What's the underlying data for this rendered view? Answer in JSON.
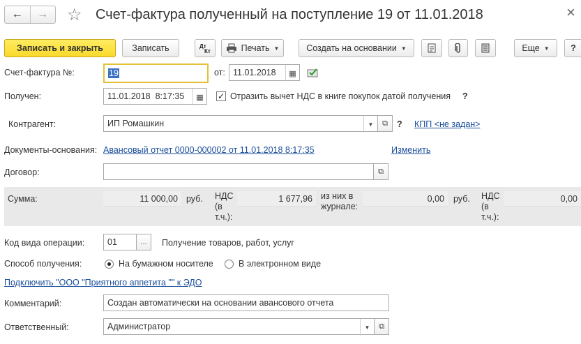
{
  "window": {
    "title": "Счет-фактура полученный на поступление 19 от 11.01.2018",
    "close_glyph": "×",
    "back_glyph": "←",
    "forward_glyph": "→",
    "star_glyph": "☆"
  },
  "toolbar": {
    "save_close_label": "Записать и закрыть",
    "save_label": "Записать",
    "print_label": "Печать",
    "create_based_label": "Создать на основании",
    "more_label": "Еще",
    "help_label": "?"
  },
  "form": {
    "invoice_label": "Счет-фактура №:",
    "invoice_number": "19",
    "from_label": "от:",
    "from_date": "11.01.2018",
    "received_label": "Получен:",
    "received_datetime": "11.01.2018  8:17:35",
    "vat_checkbox_label": "Отразить вычет НДС в книге покупок датой получения",
    "vat_checkbox_checked": true,
    "question_mark": "?",
    "counterparty_label": "Контрагент:",
    "counterparty_value": "ИП Ромашкин",
    "kpp_link": "КПП <не задан>",
    "basis_docs_label": "Документы-основания:",
    "basis_docs_link": "Авансовый отчет 0000-000002 от 11.01.2018 8:17:35",
    "change_link": "Изменить",
    "contract_label": "Договор:",
    "contract_value": ""
  },
  "sums": {
    "sum_label": "Сумма:",
    "sum_value": "11 000,00",
    "currency1": "руб.",
    "vat_label_1": "НДС",
    "vat_label_2": "(в",
    "vat_label_3": "т.ч.):",
    "vat_value": "1 677,96",
    "journal_label_1": "из них в",
    "journal_label_2": "журнале:",
    "journal_value": "0,00",
    "currency2": "руб.",
    "vat2_label_1": "НДС",
    "vat2_label_2": "(в",
    "vat2_label_3": "т.ч.):",
    "vat2_value": "0,00"
  },
  "operation": {
    "code_label": "Код вида операции:",
    "code_value": "01",
    "code_description": "Получение товаров, работ, услуг",
    "method_label": "Способ получения:",
    "method_paper": "На бумажном носителе",
    "method_electronic": "В электронном виде",
    "method_selected": "paper",
    "edo_link": "Подключить \"ООО \"Приятного аппетита \"\" к ЭДО",
    "comment_label": "Комментарий:",
    "comment_value": "Создан автоматически на основании авансового отчета",
    "responsible_label": "Ответственный:",
    "responsible_value": "Администратор"
  },
  "colors": {
    "accent_yellow": "#f9d92a",
    "link_blue": "#1b4e9b",
    "focus_border": "#e3c23a",
    "panel_gray": "#e9e9e9"
  }
}
